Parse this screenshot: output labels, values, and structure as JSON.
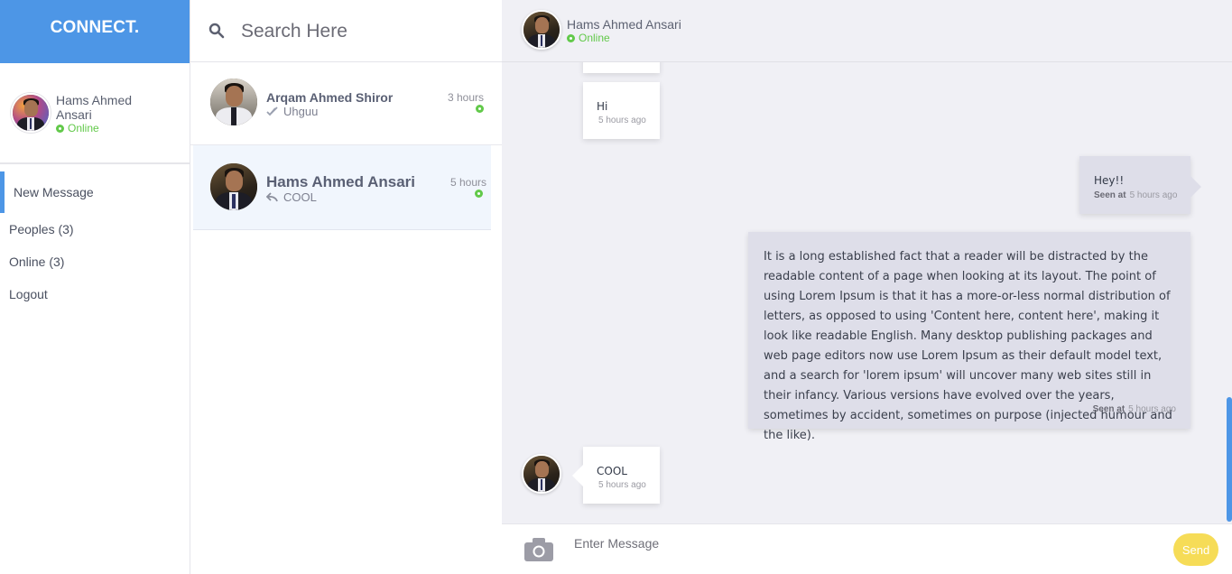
{
  "brand": "CONNECT.",
  "profile": {
    "name": "Hams Ahmed Ansari",
    "status": "Online"
  },
  "menu": [
    {
      "label": "New Message"
    },
    {
      "label": "Peoples (3)"
    },
    {
      "label": "Online (3)"
    },
    {
      "label": "Logout"
    }
  ],
  "search": {
    "placeholder": "Search Here"
  },
  "contacts": [
    {
      "name": "Arqam Ahmed Shiror",
      "preview": "Uhguu",
      "time": "3 hours",
      "preview_icon": "double-check-icon"
    },
    {
      "name": "Hams Ahmed Ansari",
      "preview": "COOL",
      "time": "5 hours",
      "preview_icon": "reply-icon"
    }
  ],
  "chat": {
    "header": {
      "name": "Hams Ahmed Ansari",
      "status": "Online"
    },
    "messages": [
      {
        "text": "Hi",
        "time": "5 hours ago"
      },
      {
        "text": "Hey!!",
        "seen_label": "Seen at",
        "time": "5 hours ago"
      },
      {
        "text": "It is a long established fact that a reader will be distracted by the readable content of a page when looking at its layout. The point of using Lorem Ipsum is that it has a more-or-less normal distribution of letters, as opposed to using 'Content here, content here', making it look like readable English. Many desktop publishing packages and web page editors now use Lorem Ipsum as their default model text, and a search for 'lorem ipsum' will uncover many web sites still in their infancy. Various versions have evolved over the years, sometimes by accident, sometimes on purpose (injected humour and the like).",
        "seen_label": "Seen at",
        "time": "5 hours ago"
      },
      {
        "text": "COOL",
        "time": "5 hours ago"
      }
    ]
  },
  "composer": {
    "placeholder": "Enter Message",
    "send_label": "Send"
  },
  "colors": {
    "accent": "#4d96e6",
    "online": "#62c94a",
    "send": "#f6dc57",
    "chat_bg": "#f0f0f5"
  }
}
